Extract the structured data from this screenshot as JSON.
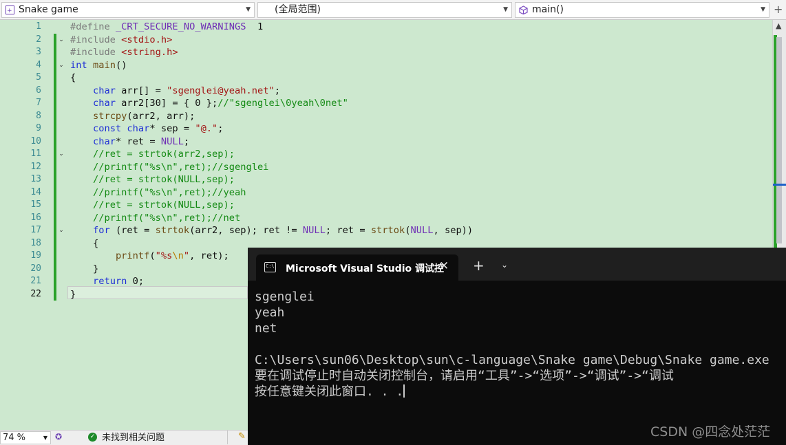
{
  "navbar": {
    "project": "Snake game",
    "scope": "(全局范围)",
    "member": "main()"
  },
  "editor": {
    "lines": [
      {
        "n": "1",
        "fold": "",
        "changed": false
      },
      {
        "n": "2",
        "fold": "⌄",
        "changed": true
      },
      {
        "n": "3",
        "fold": "",
        "changed": true
      },
      {
        "n": "4",
        "fold": "⌄",
        "changed": true
      },
      {
        "n": "5",
        "fold": "",
        "changed": true
      },
      {
        "n": "6",
        "fold": "",
        "changed": true
      },
      {
        "n": "7",
        "fold": "",
        "changed": true
      },
      {
        "n": "8",
        "fold": "",
        "changed": true
      },
      {
        "n": "9",
        "fold": "",
        "changed": true
      },
      {
        "n": "10",
        "fold": "",
        "changed": true
      },
      {
        "n": "11",
        "fold": "⌄",
        "changed": true
      },
      {
        "n": "12",
        "fold": "",
        "changed": true
      },
      {
        "n": "13",
        "fold": "",
        "changed": true
      },
      {
        "n": "14",
        "fold": "",
        "changed": true
      },
      {
        "n": "15",
        "fold": "",
        "changed": true
      },
      {
        "n": "16",
        "fold": "",
        "changed": true
      },
      {
        "n": "17",
        "fold": "⌄",
        "changed": true
      },
      {
        "n": "18",
        "fold": "",
        "changed": true
      },
      {
        "n": "19",
        "fold": "",
        "changed": true
      },
      {
        "n": "20",
        "fold": "",
        "changed": true
      },
      {
        "n": "21",
        "fold": "",
        "changed": true
      },
      {
        "n": "22",
        "fold": "",
        "changed": true
      }
    ],
    "code": [
      [
        [
          "pp",
          "#define "
        ],
        [
          "mac",
          "_CRT_SECURE_NO_WARNINGS"
        ],
        [
          "",
          "  1"
        ]
      ],
      [
        [
          "pp",
          "#include "
        ],
        [
          "str",
          "<stdio.h>"
        ]
      ],
      [
        [
          "pp",
          "#include "
        ],
        [
          "str",
          "<string.h>"
        ]
      ],
      [
        [
          "kw",
          "int"
        ],
        [
          "",
          " "
        ],
        [
          "fn",
          "main"
        ],
        [
          "",
          "()"
        ]
      ],
      [
        [
          "",
          "{"
        ]
      ],
      [
        [
          "",
          "    "
        ],
        [
          "kw",
          "char"
        ],
        [
          "",
          " arr[] = "
        ],
        [
          "str",
          "\"sgenglei@yeah.net\""
        ],
        [
          "",
          ";"
        ]
      ],
      [
        [
          "",
          "    "
        ],
        [
          "kw",
          "char"
        ],
        [
          "",
          " arr2[30] = { 0 };"
        ],
        [
          "cm",
          "//\"sgenglei\\0yeah\\0net\""
        ]
      ],
      [
        [
          "",
          "    "
        ],
        [
          "fn",
          "strcpy"
        ],
        [
          "",
          "(arr2, arr);"
        ]
      ],
      [
        [
          "",
          "    "
        ],
        [
          "kw",
          "const"
        ],
        [
          "",
          " "
        ],
        [
          "kw",
          "char"
        ],
        [
          "",
          "* sep = "
        ],
        [
          "str",
          "\"@.\""
        ],
        [
          "",
          ";"
        ]
      ],
      [
        [
          "",
          "    "
        ],
        [
          "kw",
          "char"
        ],
        [
          "",
          "* ret = "
        ],
        [
          "mac",
          "NULL"
        ],
        [
          "",
          ";"
        ]
      ],
      [
        [
          "",
          "    "
        ],
        [
          "cm",
          "//ret = strtok(arr2,sep);"
        ]
      ],
      [
        [
          "",
          "    "
        ],
        [
          "cm",
          "//printf(\"%s\\n\",ret);//sgenglei"
        ]
      ],
      [
        [
          "",
          "    "
        ],
        [
          "cm",
          "//ret = strtok(NULL,sep);"
        ]
      ],
      [
        [
          "",
          "    "
        ],
        [
          "cm",
          "//printf(\"%s\\n\",ret);//yeah"
        ]
      ],
      [
        [
          "",
          "    "
        ],
        [
          "cm",
          "//ret = strtok(NULL,sep);"
        ]
      ],
      [
        [
          "",
          "    "
        ],
        [
          "cm",
          "//printf(\"%s\\n\",ret);//net"
        ]
      ],
      [
        [
          "",
          "    "
        ],
        [
          "kw",
          "for"
        ],
        [
          "",
          " (ret = "
        ],
        [
          "fn",
          "strtok"
        ],
        [
          "",
          "(arr2, sep); ret != "
        ],
        [
          "mac",
          "NULL"
        ],
        [
          "",
          "; ret = "
        ],
        [
          "fn",
          "strtok"
        ],
        [
          "",
          "("
        ],
        [
          "mac",
          "NULL"
        ],
        [
          "",
          ", sep))"
        ]
      ],
      [
        [
          "",
          "    {"
        ]
      ],
      [
        [
          "",
          "        "
        ],
        [
          "fn",
          "printf"
        ],
        [
          "",
          "("
        ],
        [
          "str",
          "\"%s"
        ],
        [
          "esc",
          "\\n"
        ],
        [
          "str",
          "\""
        ],
        [
          "",
          ", ret);"
        ]
      ],
      [
        [
          "",
          "    }"
        ]
      ],
      [
        [
          "",
          "    "
        ],
        [
          "kw",
          "return"
        ],
        [
          "",
          " 0;"
        ]
      ],
      [
        [
          "",
          "}"
        ]
      ]
    ]
  },
  "status": {
    "zoom": "74 %",
    "issues": "未找到相关问题"
  },
  "console": {
    "tab_title": "Microsoft Visual Studio 调试控",
    "output_lines": [
      "sgenglei",
      "yeah",
      "net",
      "",
      "C:\\Users\\sun06\\Desktop\\sun\\c-language\\Snake game\\Debug\\Snake game.exe",
      "要在调试停止时自动关闭控制台，请启用“工具”->“选项”->“调试”->“调试",
      "按任意键关闭此窗口. . ."
    ]
  },
  "watermark": "CSDN @四念处茫茫"
}
